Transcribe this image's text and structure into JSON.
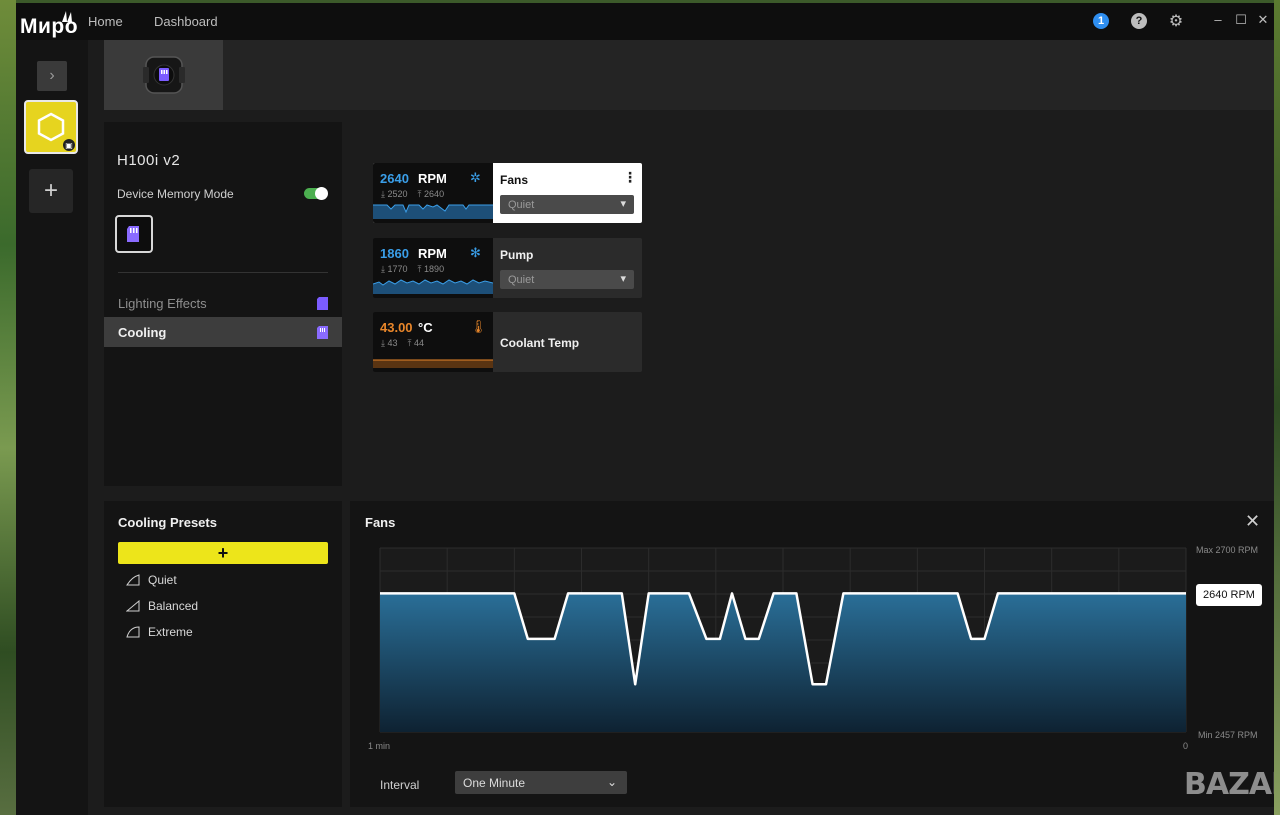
{
  "brand": "Миро",
  "nav": {
    "home": "Home",
    "dashboard": "Dashboard"
  },
  "titlebar": {
    "notification_count": "1",
    "help_glyph": "?",
    "gear_glyph": "⚙",
    "minimize": "–",
    "maximize": "☐",
    "close": "✕"
  },
  "rail": {
    "expand_glyph": "›",
    "add_glyph": "+"
  },
  "device": {
    "name": "H100i v2",
    "memory_mode_label": "Device Memory Mode",
    "memory_mode_on": true
  },
  "menu": {
    "lighting": "Lighting Effects",
    "cooling": "Cooling"
  },
  "sensors": {
    "fans": {
      "value": "2640",
      "unit": "RPM",
      "min_glyph": "⤓",
      "min": "2520",
      "max_glyph": "⤒",
      "max": "2640",
      "title": "Fans",
      "preset": "Quiet",
      "color": "#3a9ee8"
    },
    "pump": {
      "value": "1860",
      "unit": "RPM",
      "min_glyph": "⤓",
      "min": "1770",
      "max_glyph": "⤒",
      "max": "1890",
      "title": "Pump",
      "preset": "Quiet",
      "color": "#3a9ee8"
    },
    "coolant": {
      "value": "43.00",
      "unit": "°C",
      "min_glyph": "⤓",
      "min": "43",
      "max_glyph": "⤒",
      "max": "44",
      "title": "Coolant Temp",
      "color": "#e8862a"
    }
  },
  "presets": {
    "title": "Cooling Presets",
    "add_glyph": "+",
    "items": [
      "Quiet",
      "Balanced",
      "Extreme"
    ]
  },
  "graph": {
    "title": "Fans",
    "close_glyph": "✕",
    "max_label": "Max 2700 RPM",
    "min_label": "Min 2457 RPM",
    "x_start_label": "1 min",
    "x_end_label": "0",
    "current_label": "2640 RPM",
    "interval_label": "Interval",
    "interval_value": "One Minute",
    "chevron": "⌄"
  },
  "chart_data": {
    "type": "area",
    "title": "Fans",
    "xlabel": "",
    "ylabel": "",
    "x_range_seconds": [
      -60,
      0
    ],
    "ylim": [
      2457,
      2700
    ],
    "grid": true,
    "series": [
      {
        "color": "#ffffff",
        "points": [
          [
            -60,
            2640
          ],
          [
            -50,
            2640
          ],
          [
            -49,
            2580
          ],
          [
            -47,
            2580
          ],
          [
            -46,
            2640
          ],
          [
            -42,
            2640
          ],
          [
            -41,
            2520
          ],
          [
            -40,
            2640
          ],
          [
            -37,
            2640
          ],
          [
            -35.7,
            2580
          ],
          [
            -34.7,
            2580
          ],
          [
            -33.8,
            2640
          ],
          [
            -32.8,
            2580
          ],
          [
            -31.8,
            2580
          ],
          [
            -30.7,
            2640
          ],
          [
            -29,
            2640
          ],
          [
            -27.8,
            2520
          ],
          [
            -26.8,
            2520
          ],
          [
            -25.5,
            2640
          ],
          [
            -17,
            2640
          ],
          [
            -16,
            2580
          ],
          [
            -15,
            2580
          ],
          [
            -14,
            2640
          ],
          [
            0,
            2640
          ]
        ]
      }
    ],
    "current_value": 2640
  },
  "colors": {
    "accent_yellow": "#ede51a",
    "rpm_blue": "#3a9ee8",
    "temp_orange": "#e8862a",
    "toggle_green": "#4caf50"
  },
  "watermark": "BAZAR"
}
